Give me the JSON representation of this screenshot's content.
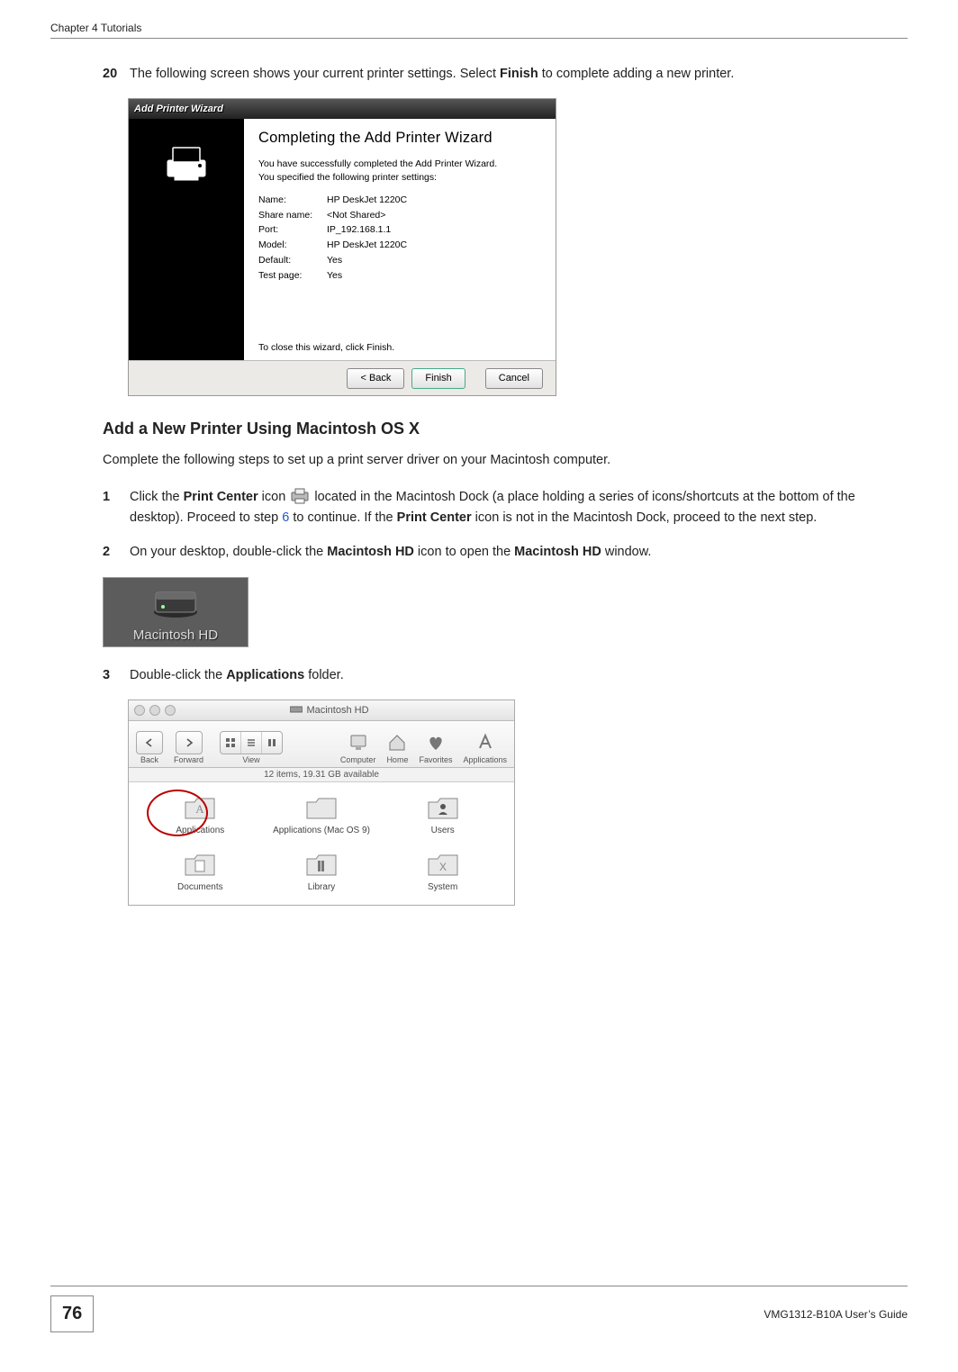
{
  "header": {
    "left": "Chapter 4 Tutorials"
  },
  "steps": {
    "s20_num": "20",
    "s20_a": "The following screen shows your current printer settings. Select ",
    "s20_b": "Finish",
    "s20_c": " to complete adding a new printer.",
    "s1_num": "1",
    "s1_a": "Click the ",
    "s1_b": "Print Center",
    "s1_c": " icon ",
    "s1_d": " located in the Macintosh Dock (a place holding a series of icons/shortcuts at the bottom of the desktop). Proceed to step ",
    "s1_link": "6",
    "s1_e": " to continue. If the ",
    "s1_f": "Print Center",
    "s1_g": " icon is not in the Macintosh Dock, proceed to the next step.",
    "s2_num": "2",
    "s2_a": "On your desktop, double-click the ",
    "s2_b": "Macintosh HD",
    "s2_c": " icon to open the ",
    "s2_d": "Macintosh HD",
    "s2_e": " window.",
    "s3_num": "3",
    "s3_a": "Double-click the ",
    "s3_b": "Applications",
    "s3_c": " folder."
  },
  "section_title": "Add a New Printer Using Macintosh OS X",
  "section_intro": "Complete the following steps to set up a print server driver on your Macintosh computer.",
  "wizard": {
    "title": "Add Printer Wizard",
    "heading": "Completing the Add Printer Wizard",
    "note1": "You have successfully completed the Add Printer Wizard.",
    "note2": "You specified the following printer settings:",
    "fields": {
      "name_l": "Name:",
      "name_v": "HP DeskJet 1220C",
      "share_l": "Share name:",
      "share_v": "<Not Shared>",
      "port_l": "Port:",
      "port_v": "IP_192.168.1.1",
      "model_l": "Model:",
      "model_v": "HP DeskJet 1220C",
      "default_l": "Default:",
      "default_v": "Yes",
      "test_l": "Test page:",
      "test_v": "Yes"
    },
    "close_note": "To close this wizard, click Finish.",
    "btn_back": "< Back",
    "btn_finish": "Finish",
    "btn_cancel": "Cancel"
  },
  "machd": {
    "label": "Macintosh HD"
  },
  "finder": {
    "title": "Macintosh HD",
    "tb_back": "Back",
    "tb_forward": "Forward",
    "tb_view": "View",
    "tb_computer": "Computer",
    "tb_home": "Home",
    "tb_favorites": "Favorites",
    "tb_applications": "Applications",
    "status": "12 items, 19.31 GB available",
    "items": {
      "applications": "Applications",
      "apps9": "Applications (Mac OS 9)",
      "users": "Users",
      "documents": "Documents",
      "library": "Library",
      "system": "System"
    }
  },
  "footer": {
    "page_number": "76",
    "guide": "VMG1312-B10A User’s Guide"
  }
}
